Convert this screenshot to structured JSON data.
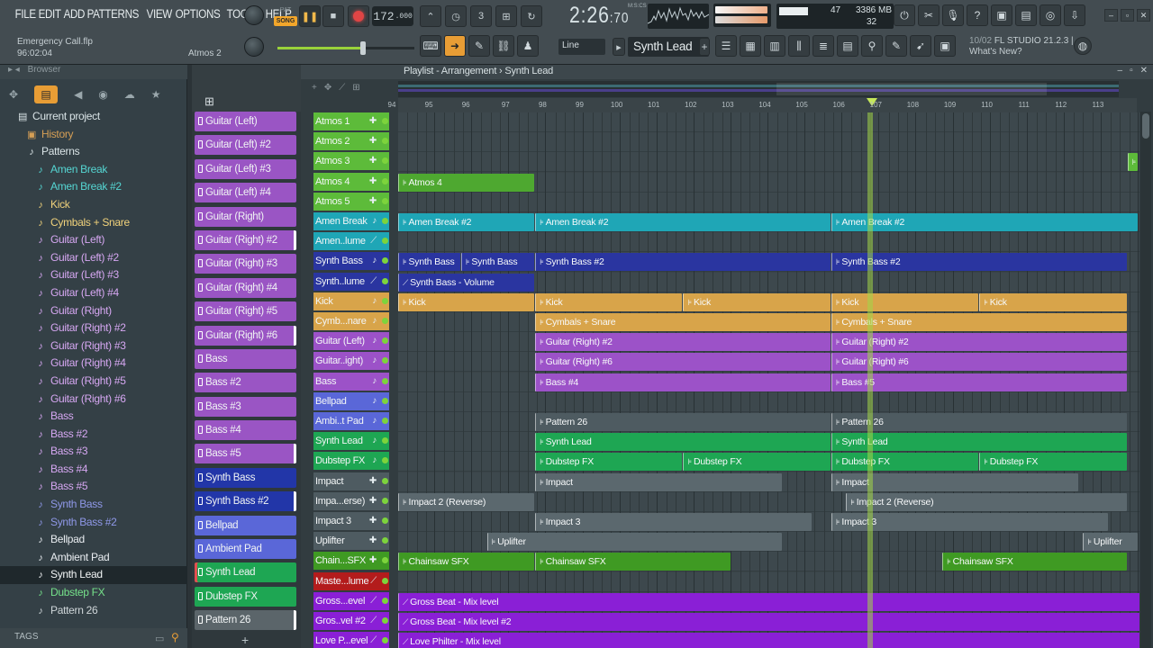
{
  "menu": [
    "FILE",
    "EDIT",
    "ADD",
    "PATTERNS",
    "VIEW",
    "OPTIONS",
    "TOOLS",
    "HELP"
  ],
  "project": {
    "file": "Emergency Call.flp",
    "time": "96:02:04",
    "hint": "Atmos 2"
  },
  "transport": {
    "mode_pat": "PAT",
    "mode_song": "SONG",
    "tempo": "172",
    "tempo_dec": ".000",
    "time_main": "2:26",
    "time_sub": "70",
    "mcs": "M:S:CS"
  },
  "cpu": {
    "cpu_val": "47",
    "mem": "3386 MB",
    "poly": "32"
  },
  "snap": "Line",
  "current_pattern": "Synth Lead",
  "news": {
    "date": "10/02",
    "text": "FL STUDIO 21.2.3 |",
    "sub": "What's New?"
  },
  "browser": {
    "title": "Browser",
    "tags_label": "TAGS",
    "items": [
      {
        "label": "Current project",
        "color": "#d9e3e6",
        "icon": "folder-icon",
        "glyph": "▤",
        "indent": 18
      },
      {
        "label": "History",
        "color": "#d69f55",
        "icon": "history-folder-icon",
        "glyph": "▣",
        "indent": 28
      },
      {
        "label": "Patterns",
        "color": "#d9e3e6",
        "icon": "patterns-folder-icon",
        "glyph": "♪",
        "indent": 28
      },
      {
        "label": "Amen Break",
        "color": "#55d6d3",
        "icon": "pattern-icon",
        "glyph": "♪",
        "indent": 38
      },
      {
        "label": "Amen Break #2",
        "color": "#55d6d3",
        "icon": "pattern-icon",
        "glyph": "♪",
        "indent": 38
      },
      {
        "label": "Kick",
        "color": "#f1d27b",
        "icon": "pattern-icon",
        "glyph": "♪",
        "indent": 38
      },
      {
        "label": "Cymbals + Snare",
        "color": "#f1d27b",
        "icon": "pattern-icon",
        "glyph": "♪",
        "indent": 38
      },
      {
        "label": "Guitar (Left)",
        "color": "#d6a7f2",
        "icon": "pattern-icon",
        "glyph": "♪",
        "indent": 38
      },
      {
        "label": "Guitar (Left) #2",
        "color": "#d6a7f2",
        "icon": "pattern-icon",
        "glyph": "♪",
        "indent": 38
      },
      {
        "label": "Guitar (Left) #3",
        "color": "#d6a7f2",
        "icon": "pattern-icon",
        "glyph": "♪",
        "indent": 38
      },
      {
        "label": "Guitar (Left) #4",
        "color": "#d6a7f2",
        "icon": "pattern-icon",
        "glyph": "♪",
        "indent": 38
      },
      {
        "label": "Guitar (Right)",
        "color": "#d6a7f2",
        "icon": "pattern-icon",
        "glyph": "♪",
        "indent": 38
      },
      {
        "label": "Guitar (Right) #2",
        "color": "#d6a7f2",
        "icon": "pattern-icon",
        "glyph": "♪",
        "indent": 38
      },
      {
        "label": "Guitar (Right) #3",
        "color": "#d6a7f2",
        "icon": "pattern-icon",
        "glyph": "♪",
        "indent": 38
      },
      {
        "label": "Guitar (Right) #4",
        "color": "#d6a7f2",
        "icon": "pattern-icon",
        "glyph": "♪",
        "indent": 38
      },
      {
        "label": "Guitar (Right) #5",
        "color": "#d6a7f2",
        "icon": "pattern-icon",
        "glyph": "♪",
        "indent": 38
      },
      {
        "label": "Guitar (Right) #6",
        "color": "#d6a7f2",
        "icon": "pattern-icon",
        "glyph": "♪",
        "indent": 38
      },
      {
        "label": "Bass",
        "color": "#d6a7f2",
        "icon": "pattern-icon",
        "glyph": "♪",
        "indent": 38
      },
      {
        "label": "Bass #2",
        "color": "#d6a7f2",
        "icon": "pattern-icon",
        "glyph": "♪",
        "indent": 38
      },
      {
        "label": "Bass #3",
        "color": "#d6a7f2",
        "icon": "pattern-icon",
        "glyph": "♪",
        "indent": 38
      },
      {
        "label": "Bass #4",
        "color": "#d6a7f2",
        "icon": "pattern-icon",
        "glyph": "♪",
        "indent": 38
      },
      {
        "label": "Bass #5",
        "color": "#d6a7f2",
        "icon": "pattern-icon",
        "glyph": "♪",
        "indent": 38
      },
      {
        "label": "Synth Bass",
        "color": "#8f98e8",
        "icon": "pattern-icon",
        "glyph": "♪",
        "indent": 38
      },
      {
        "label": "Synth Bass #2",
        "color": "#8f98e8",
        "icon": "pattern-icon",
        "glyph": "♪",
        "indent": 38
      },
      {
        "label": "Bellpad",
        "color": "#e8ecf0",
        "icon": "pattern-icon",
        "glyph": "♪",
        "indent": 38
      },
      {
        "label": "Ambient Pad",
        "color": "#e8ecf0",
        "icon": "pattern-icon",
        "glyph": "♪",
        "indent": 38
      },
      {
        "label": "Synth Lead",
        "color": "#f2f5f6",
        "icon": "pattern-icon",
        "glyph": "♪",
        "indent": 38,
        "selected": true
      },
      {
        "label": "Dubstep FX",
        "color": "#75e08a",
        "icon": "pattern-icon",
        "glyph": "♪",
        "indent": 38
      },
      {
        "label": "Pattern 26",
        "color": "#cfd6d9",
        "icon": "pattern-icon",
        "glyph": "♪",
        "indent": 38
      }
    ]
  },
  "picker": [
    {
      "label": "Guitar (Left)",
      "color": "#9a55c4"
    },
    {
      "label": "Guitar (Left) #2",
      "color": "#9a55c4"
    },
    {
      "label": "Guitar (Left) #3",
      "color": "#9a55c4"
    },
    {
      "label": "Guitar (Left) #4",
      "color": "#9a55c4"
    },
    {
      "label": "Guitar (Right)",
      "color": "#9a55c4"
    },
    {
      "label": "Guitar (Right) #2",
      "color": "#9a55c4",
      "edge": true
    },
    {
      "label": "Guitar (Right) #3",
      "color": "#9a55c4"
    },
    {
      "label": "Guitar (Right) #4",
      "color": "#9a55c4"
    },
    {
      "label": "Guitar (Right) #5",
      "color": "#9a55c4"
    },
    {
      "label": "Guitar (Right) #6",
      "color": "#9a55c4",
      "edge": true
    },
    {
      "label": "Bass",
      "color": "#9a55c4"
    },
    {
      "label": "Bass #2",
      "color": "#9a55c4"
    },
    {
      "label": "Bass #3",
      "color": "#9a55c4"
    },
    {
      "label": "Bass #4",
      "color": "#9a55c4"
    },
    {
      "label": "Bass #5",
      "color": "#9a55c4",
      "edge": true
    },
    {
      "label": "Synth Bass",
      "color": "#2236a8"
    },
    {
      "label": "Synth Bass #2",
      "color": "#2236a8",
      "edge": true
    },
    {
      "label": "Bellpad",
      "color": "#5a67d8"
    },
    {
      "label": "Ambient Pad",
      "color": "#5a67d8"
    },
    {
      "label": "Synth Lead",
      "color": "#1ea653",
      "sel": true
    },
    {
      "label": "Dubstep FX",
      "color": "#1ea653"
    },
    {
      "label": "Pattern 26",
      "color": "#5b656a",
      "edge": true
    }
  ],
  "playlist": {
    "title": "Playlist - Arrangement › Synth Lead",
    "bars": [
      "94",
      "95",
      "96",
      "97",
      "98",
      "99",
      "100",
      "101",
      "102",
      "103",
      "104",
      "105",
      "106",
      "107",
      "108",
      "109",
      "110",
      "111",
      "112",
      "113"
    ],
    "tracks": [
      {
        "name": "Atmos 1",
        "color": "#5dbb3a",
        "ctrl": "✚"
      },
      {
        "name": "Atmos 2",
        "color": "#5dbb3a",
        "ctrl": "✚"
      },
      {
        "name": "Atmos 3",
        "color": "#5dbb3a",
        "ctrl": "✚"
      },
      {
        "name": "Atmos 4",
        "color": "#5dbb3a",
        "ctrl": "✚"
      },
      {
        "name": "Atmos 5",
        "color": "#5dbb3a",
        "ctrl": "✚"
      },
      {
        "name": "Amen Break",
        "color": "#1fa6b6",
        "ctrl": "♪"
      },
      {
        "name": "Amen..lume",
        "color": "#1fa6b6",
        "ctrl": "⟋"
      },
      {
        "name": "Synth Bass",
        "color": "#2a35a0",
        "ctrl": "♪"
      },
      {
        "name": "Synth..lume",
        "color": "#2a35a0",
        "ctrl": "⟋"
      },
      {
        "name": "Kick",
        "color": "#d8a44a",
        "ctrl": "♪"
      },
      {
        "name": "Cymb...nare",
        "color": "#d8a44a",
        "ctrl": "♪"
      },
      {
        "name": "Guitar (Left)",
        "color": "#9c52c8",
        "ctrl": "♪"
      },
      {
        "name": "Guitar..ight)",
        "color": "#9c52c8",
        "ctrl": "♪"
      },
      {
        "name": "Bass",
        "color": "#9c52c8",
        "ctrl": "♪"
      },
      {
        "name": "Bellpad",
        "color": "#5a67d8",
        "ctrl": "♪"
      },
      {
        "name": "Ambi..t Pad",
        "color": "#5a67d8",
        "ctrl": "♪"
      },
      {
        "name": "Synth Lead",
        "color": "#1ea653",
        "ctrl": "♪"
      },
      {
        "name": "Dubstep FX",
        "color": "#1ea653",
        "ctrl": "♪"
      },
      {
        "name": "Impact",
        "color": "#4e5b61",
        "ctrl": "✚"
      },
      {
        "name": "Impa...erse)",
        "color": "#4e5b61",
        "ctrl": "✚"
      },
      {
        "name": "Impact 3",
        "color": "#4e5b61",
        "ctrl": "✚"
      },
      {
        "name": "Uplifter",
        "color": "#4e5b61",
        "ctrl": "✚"
      },
      {
        "name": "Chain...SFX",
        "color": "#3f9a23",
        "ctrl": "✚"
      },
      {
        "name": "Maste...lume",
        "color": "#b31c1c",
        "ctrl": "⟋"
      },
      {
        "name": "Gross...evel",
        "color": "#8a1fd6",
        "ctrl": "⟋"
      },
      {
        "name": "Gros..vel #2",
        "color": "#8a1fd6",
        "ctrl": "⟋"
      },
      {
        "name": "Love P...evel",
        "color": "#8a1fd6",
        "ctrl": "⟋"
      }
    ],
    "clips": [
      {
        "row": 2,
        "start": 19.7,
        "len": 0.3,
        "label": "",
        "color": "#5dbb3a"
      },
      {
        "row": 3,
        "start": 0,
        "len": 3.7,
        "label": "Atmos 4",
        "color": "#4ea830"
      },
      {
        "row": 5,
        "start": 0,
        "len": 3.7,
        "label": "Amen Break #2",
        "color": "#1fa6b6"
      },
      {
        "row": 5,
        "start": 3.7,
        "len": 8,
        "label": "Amen Break #2",
        "color": "#1fa6b6"
      },
      {
        "row": 5,
        "start": 11.7,
        "len": 8.3,
        "label": "Amen Break #2",
        "color": "#1fa6b6"
      },
      {
        "row": 7,
        "start": 0,
        "len": 1.7,
        "label": "Synth Bass",
        "color": "#2a35a0"
      },
      {
        "row": 7,
        "start": 1.7,
        "len": 2,
        "label": "Synth Bass",
        "color": "#2a35a0"
      },
      {
        "row": 7,
        "start": 3.7,
        "len": 8,
        "label": "Synth Bass #2",
        "color": "#2a35a0"
      },
      {
        "row": 7,
        "start": 11.7,
        "len": 8,
        "label": "Synth Bass #2",
        "color": "#2a35a0"
      },
      {
        "row": 8,
        "start": 0,
        "len": 3.7,
        "label": "Synth Bass - Volume",
        "color": "#2a35a0",
        "auto": true
      },
      {
        "row": 9,
        "start": 0,
        "len": 3.7,
        "label": "Kick",
        "color": "#d8a44a"
      },
      {
        "row": 9,
        "start": 3.7,
        "len": 4,
        "label": "Kick",
        "color": "#d8a44a"
      },
      {
        "row": 9,
        "start": 7.7,
        "len": 4,
        "label": "Kick",
        "color": "#d8a44a"
      },
      {
        "row": 9,
        "start": 11.7,
        "len": 4,
        "label": "Kick",
        "color": "#d8a44a"
      },
      {
        "row": 9,
        "start": 15.7,
        "len": 4,
        "label": "Kick",
        "color": "#d8a44a"
      },
      {
        "row": 10,
        "start": 3.7,
        "len": 8,
        "label": "Cymbals + Snare",
        "color": "#d8a44a"
      },
      {
        "row": 10,
        "start": 11.7,
        "len": 8,
        "label": "Cymbals + Snare",
        "color": "#d8a44a"
      },
      {
        "row": 11,
        "start": 3.7,
        "len": 8,
        "label": "Guitar (Right) #2",
        "color": "#9c52c8"
      },
      {
        "row": 11,
        "start": 11.7,
        "len": 8,
        "label": "Guitar (Right) #2",
        "color": "#9c52c8"
      },
      {
        "row": 12,
        "start": 3.7,
        "len": 8,
        "label": "Guitar (Right) #6",
        "color": "#9c52c8"
      },
      {
        "row": 12,
        "start": 11.7,
        "len": 8,
        "label": "Guitar (Right) #6",
        "color": "#9c52c8"
      },
      {
        "row": 13,
        "start": 3.7,
        "len": 8,
        "label": "Bass #4",
        "color": "#9c52c8"
      },
      {
        "row": 13,
        "start": 11.7,
        "len": 8,
        "label": "Bass #5",
        "color": "#9c52c8"
      },
      {
        "row": 15,
        "start": 3.7,
        "len": 8,
        "label": "Pattern 26",
        "color": "#4e5b61"
      },
      {
        "row": 15,
        "start": 11.7,
        "len": 8,
        "label": "Pattern 26",
        "color": "#4e5b61"
      },
      {
        "row": 16,
        "start": 3.7,
        "len": 8,
        "label": "Synth Lead",
        "color": "#1ea653"
      },
      {
        "row": 16,
        "start": 11.7,
        "len": 8,
        "label": "Synth Lead",
        "color": "#1ea653"
      },
      {
        "row": 17,
        "start": 3.7,
        "len": 4,
        "label": "Dubstep FX",
        "color": "#1ea653"
      },
      {
        "row": 17,
        "start": 7.7,
        "len": 4,
        "label": "Dubstep FX",
        "color": "#1ea653"
      },
      {
        "row": 17,
        "start": 11.7,
        "len": 4,
        "label": "Dubstep FX",
        "color": "#1ea653"
      },
      {
        "row": 17,
        "start": 15.7,
        "len": 4,
        "label": "Dubstep FX",
        "color": "#1ea653"
      },
      {
        "row": 18,
        "start": 3.7,
        "len": 6.7,
        "label": "Impact",
        "color": "#5b686e"
      },
      {
        "row": 18,
        "start": 11.7,
        "len": 6.7,
        "label": "Impact",
        "color": "#5b686e"
      },
      {
        "row": 19,
        "start": 0,
        "len": 3.7,
        "label": "Impact 2 (Reverse)",
        "color": "#5b686e"
      },
      {
        "row": 19,
        "start": 12.1,
        "len": 7.6,
        "label": "Impact 2 (Reverse)",
        "color": "#5b686e"
      },
      {
        "row": 20,
        "start": 3.7,
        "len": 7.5,
        "label": "Impact 3",
        "color": "#5b686e"
      },
      {
        "row": 20,
        "start": 11.7,
        "len": 7.5,
        "label": "Impact 3",
        "color": "#5b686e"
      },
      {
        "row": 21,
        "start": 2.4,
        "len": 8,
        "label": "Uplifter",
        "color": "#5b686e"
      },
      {
        "row": 21,
        "start": 18.5,
        "len": 1.5,
        "label": "Uplifter",
        "color": "#5b686e"
      },
      {
        "row": 22,
        "start": 0,
        "len": 3.7,
        "label": "Chainsaw SFX",
        "color": "#3f9a23"
      },
      {
        "row": 22,
        "start": 3.7,
        "len": 5.3,
        "label": "Chainsaw SFX",
        "color": "#3f9a23"
      },
      {
        "row": 22,
        "start": 14.7,
        "len": 5,
        "label": "Chainsaw SFX",
        "color": "#3f9a23"
      },
      {
        "row": 24,
        "start": 0,
        "len": 20.3,
        "label": "Gross Beat - Mix level",
        "color": "#8a1fd6",
        "auto": true
      },
      {
        "row": 25,
        "start": 0,
        "len": 20.3,
        "label": "Gross Beat - Mix level #2",
        "color": "#8a1fd6",
        "auto": true
      },
      {
        "row": 26,
        "start": 0,
        "len": 20.3,
        "label": "Love Philter - Mix level",
        "color": "#8a1fd6",
        "auto": true
      }
    ]
  }
}
